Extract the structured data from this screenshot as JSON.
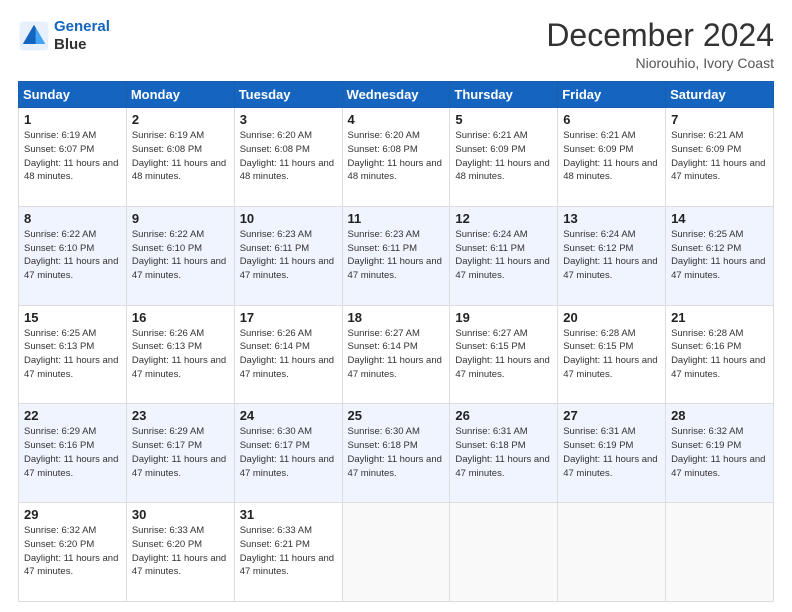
{
  "logo": {
    "line1": "General",
    "line2": "Blue"
  },
  "title": "December 2024",
  "location": "Niorouhio, Ivory Coast",
  "days_header": [
    "Sunday",
    "Monday",
    "Tuesday",
    "Wednesday",
    "Thursday",
    "Friday",
    "Saturday"
  ],
  "weeks": [
    [
      {
        "day": "1",
        "sunrise": "6:19 AM",
        "sunset": "6:07 PM",
        "daylight": "11 hours and 48 minutes."
      },
      {
        "day": "2",
        "sunrise": "6:19 AM",
        "sunset": "6:08 PM",
        "daylight": "11 hours and 48 minutes."
      },
      {
        "day": "3",
        "sunrise": "6:20 AM",
        "sunset": "6:08 PM",
        "daylight": "11 hours and 48 minutes."
      },
      {
        "day": "4",
        "sunrise": "6:20 AM",
        "sunset": "6:08 PM",
        "daylight": "11 hours and 48 minutes."
      },
      {
        "day": "5",
        "sunrise": "6:21 AM",
        "sunset": "6:09 PM",
        "daylight": "11 hours and 48 minutes."
      },
      {
        "day": "6",
        "sunrise": "6:21 AM",
        "sunset": "6:09 PM",
        "daylight": "11 hours and 48 minutes."
      },
      {
        "day": "7",
        "sunrise": "6:21 AM",
        "sunset": "6:09 PM",
        "daylight": "11 hours and 47 minutes."
      }
    ],
    [
      {
        "day": "8",
        "sunrise": "6:22 AM",
        "sunset": "6:10 PM",
        "daylight": "11 hours and 47 minutes."
      },
      {
        "day": "9",
        "sunrise": "6:22 AM",
        "sunset": "6:10 PM",
        "daylight": "11 hours and 47 minutes."
      },
      {
        "day": "10",
        "sunrise": "6:23 AM",
        "sunset": "6:11 PM",
        "daylight": "11 hours and 47 minutes."
      },
      {
        "day": "11",
        "sunrise": "6:23 AM",
        "sunset": "6:11 PM",
        "daylight": "11 hours and 47 minutes."
      },
      {
        "day": "12",
        "sunrise": "6:24 AM",
        "sunset": "6:11 PM",
        "daylight": "11 hours and 47 minutes."
      },
      {
        "day": "13",
        "sunrise": "6:24 AM",
        "sunset": "6:12 PM",
        "daylight": "11 hours and 47 minutes."
      },
      {
        "day": "14",
        "sunrise": "6:25 AM",
        "sunset": "6:12 PM",
        "daylight": "11 hours and 47 minutes."
      }
    ],
    [
      {
        "day": "15",
        "sunrise": "6:25 AM",
        "sunset": "6:13 PM",
        "daylight": "11 hours and 47 minutes."
      },
      {
        "day": "16",
        "sunrise": "6:26 AM",
        "sunset": "6:13 PM",
        "daylight": "11 hours and 47 minutes."
      },
      {
        "day": "17",
        "sunrise": "6:26 AM",
        "sunset": "6:14 PM",
        "daylight": "11 hours and 47 minutes."
      },
      {
        "day": "18",
        "sunrise": "6:27 AM",
        "sunset": "6:14 PM",
        "daylight": "11 hours and 47 minutes."
      },
      {
        "day": "19",
        "sunrise": "6:27 AM",
        "sunset": "6:15 PM",
        "daylight": "11 hours and 47 minutes."
      },
      {
        "day": "20",
        "sunrise": "6:28 AM",
        "sunset": "6:15 PM",
        "daylight": "11 hours and 47 minutes."
      },
      {
        "day": "21",
        "sunrise": "6:28 AM",
        "sunset": "6:16 PM",
        "daylight": "11 hours and 47 minutes."
      }
    ],
    [
      {
        "day": "22",
        "sunrise": "6:29 AM",
        "sunset": "6:16 PM",
        "daylight": "11 hours and 47 minutes."
      },
      {
        "day": "23",
        "sunrise": "6:29 AM",
        "sunset": "6:17 PM",
        "daylight": "11 hours and 47 minutes."
      },
      {
        "day": "24",
        "sunrise": "6:30 AM",
        "sunset": "6:17 PM",
        "daylight": "11 hours and 47 minutes."
      },
      {
        "day": "25",
        "sunrise": "6:30 AM",
        "sunset": "6:18 PM",
        "daylight": "11 hours and 47 minutes."
      },
      {
        "day": "26",
        "sunrise": "6:31 AM",
        "sunset": "6:18 PM",
        "daylight": "11 hours and 47 minutes."
      },
      {
        "day": "27",
        "sunrise": "6:31 AM",
        "sunset": "6:19 PM",
        "daylight": "11 hours and 47 minutes."
      },
      {
        "day": "28",
        "sunrise": "6:32 AM",
        "sunset": "6:19 PM",
        "daylight": "11 hours and 47 minutes."
      }
    ],
    [
      {
        "day": "29",
        "sunrise": "6:32 AM",
        "sunset": "6:20 PM",
        "daylight": "11 hours and 47 minutes."
      },
      {
        "day": "30",
        "sunrise": "6:33 AM",
        "sunset": "6:20 PM",
        "daylight": "11 hours and 47 minutes."
      },
      {
        "day": "31",
        "sunrise": "6:33 AM",
        "sunset": "6:21 PM",
        "daylight": "11 hours and 47 minutes."
      },
      null,
      null,
      null,
      null
    ]
  ]
}
